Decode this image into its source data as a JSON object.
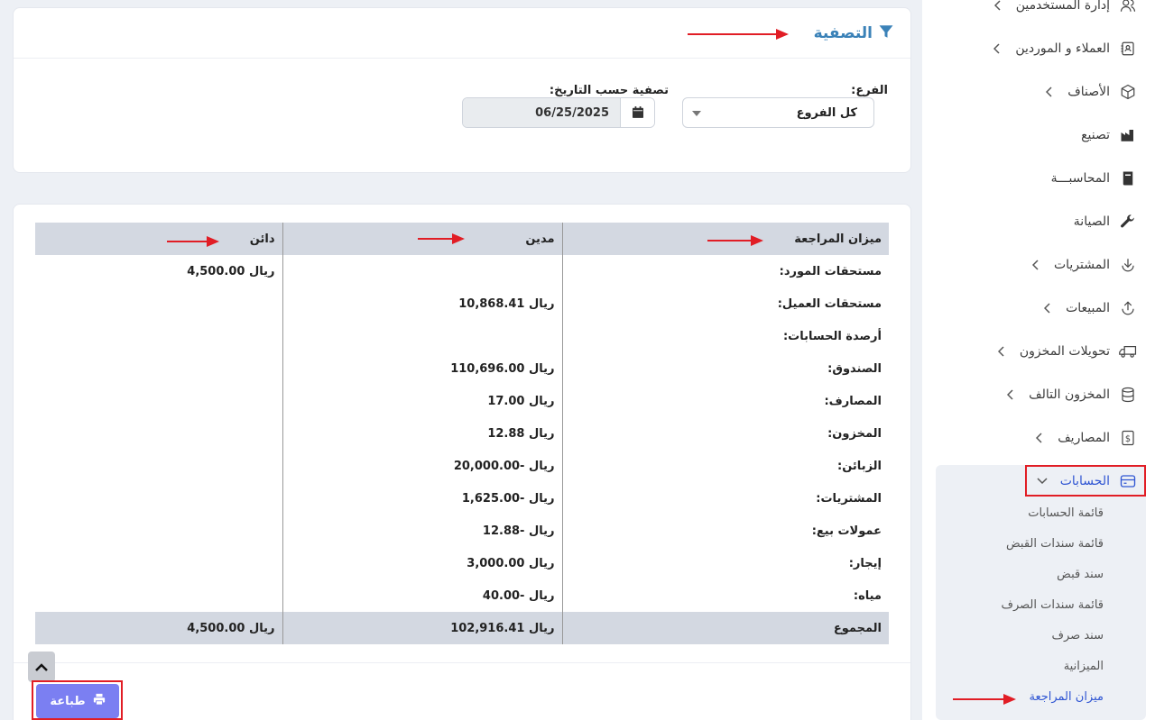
{
  "sidebar": {
    "items": [
      {
        "label": "إدارة المستخدمين",
        "icon": "users-icon",
        "has_chevron": true
      },
      {
        "label": "العملاء و الموردين",
        "icon": "contacts-book-icon",
        "has_chevron": true
      },
      {
        "label": "الأصناف",
        "icon": "box-icon",
        "has_chevron": true
      },
      {
        "label": "تصنيع",
        "icon": "factory-icon",
        "has_chevron": false
      },
      {
        "label": "المحاسبـــة",
        "icon": "book-icon",
        "has_chevron": false
      },
      {
        "label": "الصيانة",
        "icon": "wrench-icon",
        "has_chevron": false
      },
      {
        "label": "المشتريات",
        "icon": "download-icon",
        "has_chevron": true
      },
      {
        "label": "المبيعات",
        "icon": "upload-icon",
        "has_chevron": true
      },
      {
        "label": "تحويلات المخزون",
        "icon": "truck-icon",
        "has_chevron": true
      },
      {
        "label": "المخزون التالف",
        "icon": "database-icon",
        "has_chevron": true
      },
      {
        "label": "المصاريف",
        "icon": "dollar-receipt-icon",
        "has_chevron": true
      },
      {
        "label": "الحسابات",
        "icon": "credit-card-icon",
        "has_chevron": true,
        "expanded": true
      }
    ],
    "accounts_sub": [
      "قائمة الحسابات",
      "قائمة سندات القبض",
      "سند قبض",
      "قائمة سندات الصرف",
      "سند صرف",
      "الميزانية",
      "ميزان المراجعة"
    ]
  },
  "filter": {
    "title": "التصفية",
    "branch_label": "الفرع:",
    "branch_value": "كل الفروع",
    "date_label": "تصفية حسب التاريخ:",
    "date_value": "06/25/2025"
  },
  "table": {
    "headers": [
      "ميزان المراجعة",
      "مدين",
      "دائن"
    ],
    "rows": [
      [
        "مستحقات المورد:",
        "",
        "ريال 4,500.00"
      ],
      [
        "مستحقات العميل:",
        "ريال 10,868.41",
        ""
      ],
      [
        "أرصدة الحسابات:",
        "",
        ""
      ],
      [
        "الصندوق:",
        "ريال 110,696.00",
        ""
      ],
      [
        "المصارف:",
        "ريال 17.00",
        ""
      ],
      [
        "المخزون:",
        "ريال 12.88",
        ""
      ],
      [
        "الزبائن:",
        "ريال -20,000.00",
        ""
      ],
      [
        "المشتريات:",
        "ريال -1,625.00",
        ""
      ],
      [
        "عمولات بيع:",
        "ريال -12.88",
        ""
      ],
      [
        "إيجار:",
        "ريال 3,000.00",
        ""
      ],
      [
        "مياه:",
        "ريال -40.00",
        ""
      ]
    ],
    "total": [
      "المجموع",
      "ريال 102,916.41",
      "ريال 4,500.00"
    ]
  },
  "actions": {
    "print_label": "طباعة"
  },
  "colors": {
    "accent": "#3056d3",
    "annotation": "#e11d25",
    "print_button": "#7b7ff2",
    "table_header": "#d3d8e1"
  }
}
